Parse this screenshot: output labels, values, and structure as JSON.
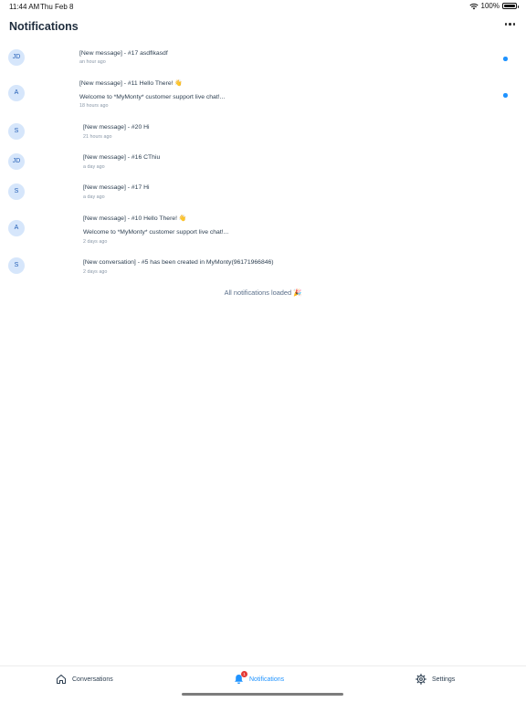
{
  "status_bar": {
    "time": "11:44 AM",
    "date": "Thu Feb 8",
    "battery": "100%",
    "battery_level": 1.0
  },
  "header": {
    "title": "Notifications",
    "more_icon": "ellipsis-icon"
  },
  "notifications": [
    {
      "initials": "JD",
      "title": "[New message] - #17 asdflkasdf",
      "preview": "",
      "time": "an hour ago",
      "unread": true
    },
    {
      "initials": "A",
      "title": "[New message] - #11 Hello There! 👋",
      "preview": "Welcome to *MyMonty* customer support live chat!...",
      "time": "18 hours ago",
      "unread": true
    },
    {
      "initials": "S",
      "title": "[New message] - #20 Hi",
      "preview": "",
      "time": "21 hours ago",
      "unread": false
    },
    {
      "initials": "JD",
      "title": "[New message] - #16 CThiu",
      "preview": "",
      "time": "a day ago",
      "unread": false
    },
    {
      "initials": "S",
      "title": "[New message] - #17 Hi",
      "preview": "",
      "time": "a day ago",
      "unread": false
    },
    {
      "initials": "A",
      "title": "[New message] - #10 Hello There! 👋",
      "preview": "Welcome to *MyMonty* customer support live chat!...",
      "time": "2 days ago",
      "unread": false
    },
    {
      "initials": "S",
      "title": "[New conversation] - #5 has been created in MyMonty(96171966846)",
      "preview": "",
      "time": "2 days ago",
      "unread": false
    }
  ],
  "footer_text": "All notifications loaded 🎉",
  "tabbar": {
    "conversations": "Conversations",
    "notifications": "Notifications",
    "settings": "Settings",
    "badge_count": "1",
    "active_tab": "notifications"
  },
  "colors": {
    "accent": "#1f93ff",
    "avatar_bg": "#d6e6fb",
    "badge": "#e53935"
  }
}
